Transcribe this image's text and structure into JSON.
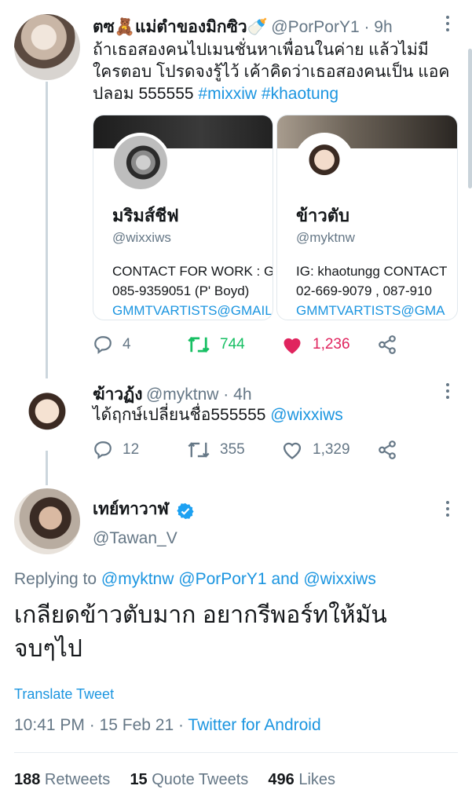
{
  "tweet1": {
    "name": "ตซ🧸แม่ตำของมิกซิว🍼",
    "handle": "@PorPorY1 · 9h",
    "text_line1": "ถ้าเธอสองคนไปเมนชั่นหาเพื่อนในค่าย แล้วไม่มี",
    "text_line2": "ใครตอบ โปรดจงรู้ไว้ เค้าคิดว่าเธอสองคนเป็น แอค",
    "text_line3_plain": "ปลอม 555555 ",
    "hashtag1": "#mixxiw",
    "hashtag2": "#khaotung",
    "cards": [
      {
        "name": "มริมส์ชีฟ",
        "handle": "@wixxiws",
        "bio1": "CONTACT FOR WORK : G",
        "bio2": "085-9359051 (P' Boyd)",
        "bio3": "GMMTVARTISTS@GMAIL"
      },
      {
        "name": "ข้าวตับ",
        "handle": "@myktnw",
        "bio1": "IG: khaotungg CONTACT",
        "bio2": "02-669-9079 , 087-910",
        "bio3": "GMMTVARTISTS@GMA"
      }
    ],
    "replies": "4",
    "retweets": "744",
    "likes": "1,236"
  },
  "tweet2": {
    "name": "ฆ้าวฏ้ง",
    "handle": "@myktnw · 4h",
    "text_plain": "ได้ฤกษ์เปลี่ยนชื่อ555555 ",
    "mention": "@wixxiws",
    "replies": "12",
    "retweets": "355",
    "likes": "1,329"
  },
  "tweet3": {
    "name": "เทย์ทาวาฬ",
    "handle": "@Tawan_V",
    "replying_label": "Replying to ",
    "reply_m1": "@myktnw",
    "reply_m2": "@PorPorY1",
    "reply_and": " and ",
    "reply_m3": "@wixxiws",
    "text_line1": "เกลียดข้าวตับมาก อยากรีพอร์ทให้มัน",
    "text_line2": "จบๆไป",
    "translate": "Translate Tweet",
    "time": "10:41 PM · 15 Feb 21 · ",
    "source": "Twitter for Android",
    "retweets_num": "188",
    "retweets_label": " Retweets",
    "quotes_num": "15",
    "quotes_label": " Quote Tweets",
    "likes_num": "496",
    "likes_label": " Likes"
  },
  "colors": {
    "link": "#1b95e0",
    "retweet_active": "#17bf63",
    "like_active": "#e0245e",
    "gray": "#657786"
  },
  "icons": [
    "reply-icon",
    "retweet-icon",
    "like-icon",
    "share-icon",
    "more-icon",
    "verified-icon"
  ]
}
